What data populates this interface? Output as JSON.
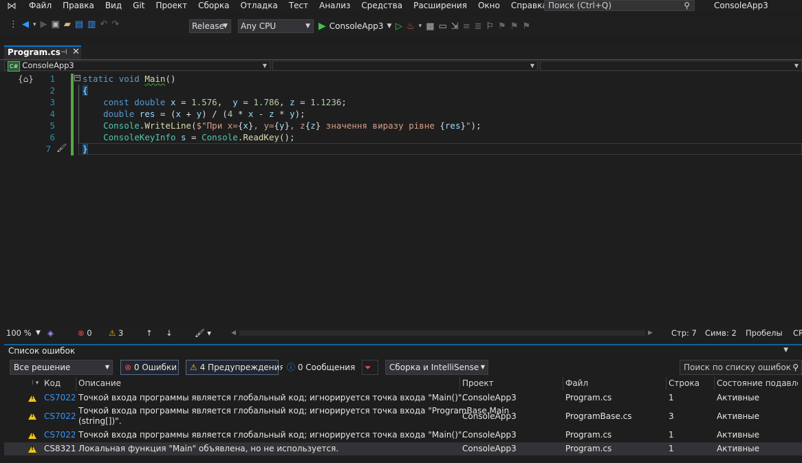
{
  "menubar": {
    "items": [
      "Файл",
      "Правка",
      "Вид",
      "Git",
      "Проект",
      "Сборка",
      "Отладка",
      "Тест",
      "Анализ",
      "Средства",
      "Расширения",
      "Окно",
      "Справка"
    ],
    "search_placeholder": "Поиск (Ctrl+Q)",
    "window_title": "ConsoleApp3"
  },
  "toolbar": {
    "config": "Release",
    "platform": "Any CPU",
    "start_label": "ConsoleApp3"
  },
  "tab": {
    "name": "Program.cs",
    "pin": "⊣",
    "close": "✕"
  },
  "navbar": {
    "project_badge": "C#",
    "project": "ConsoleApp3"
  },
  "editor": {
    "line_numbers": [
      "1",
      "2",
      "3",
      "4",
      "5",
      "6",
      "7"
    ]
  },
  "editor_status": {
    "zoom": "100 %",
    "errors": "0",
    "warnings": "3",
    "line": "Стр: 7",
    "col": "Симв: 2",
    "spaces": "Пробелы",
    "crlf": "CR"
  },
  "error_list": {
    "title": "Список ошибок",
    "scope": "Все решение",
    "errors_btn": "0 Ошибки",
    "warnings_btn": "4 Предупреждения",
    "messages_btn": "0 Сообщения",
    "build_filter": "Сборка и IntelliSense",
    "search_placeholder": "Поиск по списку ошибок",
    "columns": [
      "Код",
      "Описание",
      "Проект",
      "Файл",
      "Строка",
      "Состояние подавлени"
    ],
    "rows": [
      {
        "code": "CS7022",
        "desc": "Точкой входа программы является глобальный код; игнорируется точка входа \"Main()\".",
        "desc2": "",
        "project": "ConsoleApp3",
        "file": "Program.cs",
        "line": "1",
        "state": "Активные"
      },
      {
        "code": "CS7022",
        "desc": "Точкой входа программы является глобальный код; игнорируется точка входа \"ProgramBase.Main",
        "desc2": "(string[])\".",
        "project": "ConsoleApp3",
        "file": "ProgramBase.cs",
        "line": "3",
        "state": "Активные"
      },
      {
        "code": "CS7022",
        "desc": "Точкой входа программы является глобальный код; игнорируется точка входа \"Main()\".",
        "desc2": "",
        "project": "ConsoleApp3",
        "file": "Program.cs",
        "line": "1",
        "state": "Активные"
      },
      {
        "code": "CS8321",
        "desc": "Локальная функция \"Main\" объявлена, но не используется.",
        "desc2": "",
        "project": "ConsoleApp3",
        "file": "Program.cs",
        "line": "1",
        "state": "Активные"
      }
    ]
  }
}
